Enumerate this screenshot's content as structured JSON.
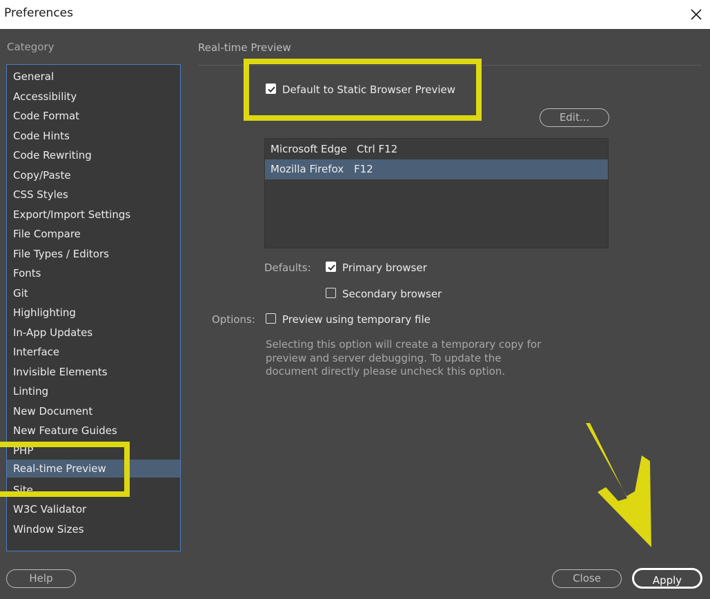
{
  "window": {
    "title": "Preferences"
  },
  "sidebar": {
    "heading": "Category",
    "items": [
      {
        "label": "General"
      },
      {
        "label": "Accessibility"
      },
      {
        "label": "Code Format"
      },
      {
        "label": "Code Hints"
      },
      {
        "label": "Code Rewriting"
      },
      {
        "label": "Copy/Paste"
      },
      {
        "label": "CSS Styles"
      },
      {
        "label": "Export/Import Settings"
      },
      {
        "label": "File Compare"
      },
      {
        "label": "File Types / Editors"
      },
      {
        "label": "Fonts"
      },
      {
        "label": "Git"
      },
      {
        "label": "Highlighting"
      },
      {
        "label": "In-App Updates"
      },
      {
        "label": "Interface"
      },
      {
        "label": "Invisible Elements"
      },
      {
        "label": "Linting"
      },
      {
        "label": "New Document"
      },
      {
        "label": "New Feature Guides"
      },
      {
        "label": "PHP"
      },
      {
        "label": "Real-time Preview"
      },
      {
        "label": "Site"
      },
      {
        "label": "W3C Validator"
      },
      {
        "label": "Window Sizes"
      }
    ],
    "selected": "Real-time Preview"
  },
  "panel": {
    "heading": "Real-time Preview",
    "static_preview": {
      "label": "Default to Static Browser Preview",
      "checked": true
    },
    "edit_button": "Edit...",
    "browsers": [
      {
        "name": "Microsoft Edge",
        "shortcut": "Ctrl F12",
        "selected": false
      },
      {
        "name": "Mozilla Firefox",
        "shortcut": "F12",
        "selected": true
      }
    ],
    "defaults_label": "Defaults:",
    "primary_browser": {
      "label": "Primary browser",
      "checked": true
    },
    "secondary_browser": {
      "label": "Secondary browser",
      "checked": false
    },
    "options_label": "Options:",
    "temp_file": {
      "label": "Preview using temporary file",
      "checked": false
    },
    "note": "Selecting this option will create a temporary copy for preview and server debugging. To update the document directly please uncheck this option."
  },
  "footer": {
    "help": "Help",
    "close": "Close",
    "apply": "Apply"
  },
  "annotations": {
    "highlight_color": "#ddd812"
  }
}
